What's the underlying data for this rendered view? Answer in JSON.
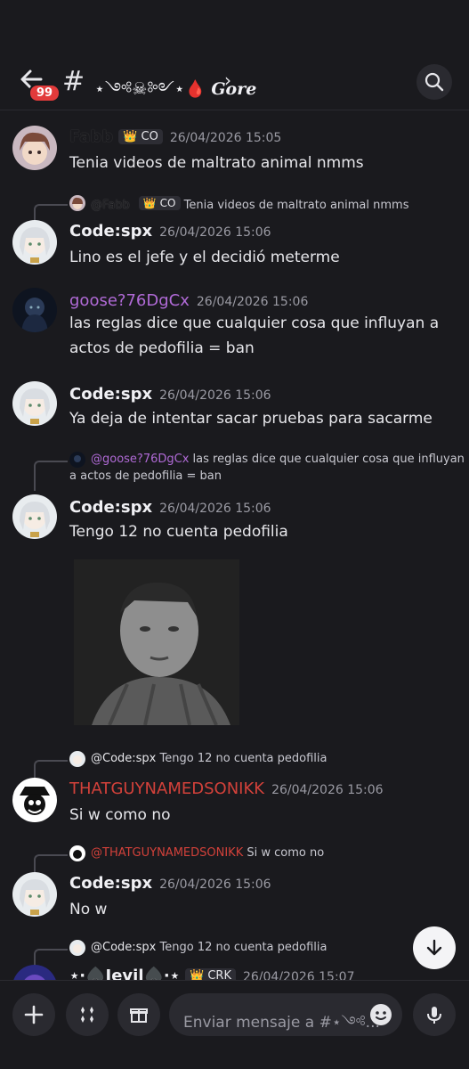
{
  "header": {
    "notif_count": "99",
    "channel_title": "⋆༺☠︎༻⋆🩸",
    "channel_suffix": "Gore"
  },
  "messages": [
    {
      "author": "Fabb",
      "role": "CO",
      "time": "26/04/2026 15:05",
      "text": "Tenia videos de maltrato animal nmms",
      "name_color": "#1a1a1e"
    },
    {
      "reply_author": "@Fabb",
      "reply_role": "CO",
      "reply_text": "Tenia videos de maltrato animal nmms",
      "author": "Code:spx",
      "time": "26/04/2026 15:06",
      "text": "Lino es el jefe y el decidió meterme",
      "name_color": "#f0f0f4"
    },
    {
      "author": "goose?76DgCx",
      "time": "26/04/2026 15:06",
      "text": "las reglas dice que cualquier cosa que influyan a actos de pedofilia = ban",
      "name_color": "#b06ad6"
    },
    {
      "author": "Code:spx",
      "time": "26/04/2026 15:06",
      "text": "Ya deja de intentar sacar pruebas para sacarme",
      "name_color": "#f0f0f4"
    },
    {
      "reply_author": "@goose?76DgCx",
      "reply_text_line1": "las reglas dice que cualquier cosa que influyan",
      "reply_text_line2": "a actos de pedofilia = ban",
      "author": "Code:spx",
      "time": "26/04/2026 15:06",
      "text": "Tengo 12 no cuenta pedofilia",
      "name_color": "#f0f0f4"
    },
    {
      "reply_author": "@Code:spx",
      "reply_text": "Tengo 12 no cuenta pedofilia",
      "author": "THATGUYNAMEDSONIKK",
      "time": "26/04/2026 15:06",
      "text": "Si w como no",
      "name_color": "#d2413a"
    },
    {
      "reply_author": "@THATGUYNAMEDSONIKK",
      "reply_text": "Si w como no",
      "author": "Code:spx",
      "time": "26/04/2026 15:06",
      "text": "No w",
      "name_color": "#f0f0f4"
    },
    {
      "reply_author": "@Code:spx",
      "reply_text": "Tengo 12 no cuenta pedofilia",
      "author": "⋆·♠️Jevil♠️·⋆",
      "role": "CRK",
      "time": "26/04/2026 15:07",
      "name_color": "#f0f0f4"
    }
  ],
  "composer": {
    "placeholder": "Enviar mensaje a #⋆༺..."
  }
}
